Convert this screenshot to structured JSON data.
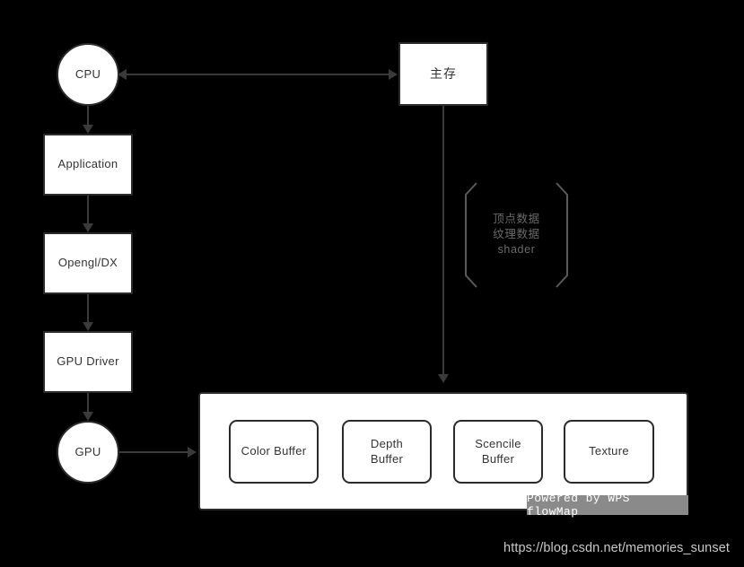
{
  "diagram": {
    "background_color": "#000000",
    "node_fill": "#ffffff",
    "node_stroke": "#2b2b2b",
    "edge_color": "#3a3a3a",
    "annotation_color": "#6a6a6a",
    "nodes": {
      "cpu": {
        "label": "CPU",
        "shape": "circle"
      },
      "application": {
        "label": "Application",
        "shape": "rect"
      },
      "opengl_dx": {
        "label": "Opengl/DX",
        "shape": "rect"
      },
      "gpu_driver": {
        "label": "GPU Driver",
        "shape": "rect"
      },
      "gpu": {
        "label": "GPU",
        "shape": "circle"
      },
      "main_memory": {
        "label": "主存",
        "shape": "rect"
      }
    },
    "buffers": [
      {
        "label": "Color Buffer"
      },
      {
        "label": "Depth\nBuffer"
      },
      {
        "label": "Scencile\nBuffer"
      },
      {
        "label": "Texture"
      }
    ],
    "annotation": {
      "text": "顶点数据\n纹理数据\nshader"
    },
    "watermark": "Powered by WPS flowMap",
    "footer_url": "https://blog.csdn.net/memories_sunset"
  }
}
